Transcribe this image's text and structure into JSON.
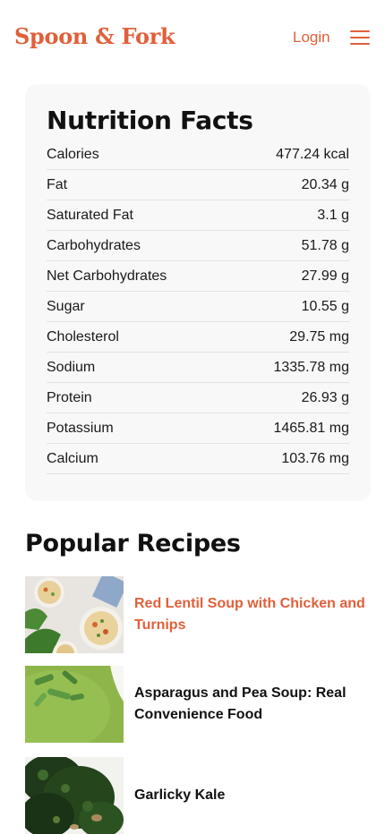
{
  "header": {
    "logo": "Spoon & Fork",
    "login_label": "Login",
    "menu_icon": "hamburger-menu-icon",
    "accent_color": "#e0603a"
  },
  "nutrition": {
    "title": "Nutrition Facts",
    "rows": [
      {
        "label": "Calories",
        "value": "477.24 kcal"
      },
      {
        "label": "Fat",
        "value": "20.34 g"
      },
      {
        "label": "Saturated Fat",
        "value": "3.1 g"
      },
      {
        "label": "Carbohydrates",
        "value": "51.78 g"
      },
      {
        "label": "Net Carbohydrates",
        "value": "27.99 g"
      },
      {
        "label": "Sugar",
        "value": "10.55 g"
      },
      {
        "label": "Cholesterol",
        "value": "29.75 mg"
      },
      {
        "label": "Sodium",
        "value": "1335.78 mg"
      },
      {
        "label": "Protein",
        "value": "26.93 g"
      },
      {
        "label": "Potassium",
        "value": "1465.81 mg"
      },
      {
        "label": "Calcium",
        "value": "103.76 mg"
      }
    ]
  },
  "popular": {
    "title": "Popular Recipes",
    "recipes": [
      {
        "title": "Red Lentil Soup with Chicken and Turnips",
        "active": true
      },
      {
        "title": "Asparagus and Pea Soup: Real Convenience Food",
        "active": false
      },
      {
        "title": "Garlicky Kale",
        "active": false
      }
    ]
  }
}
